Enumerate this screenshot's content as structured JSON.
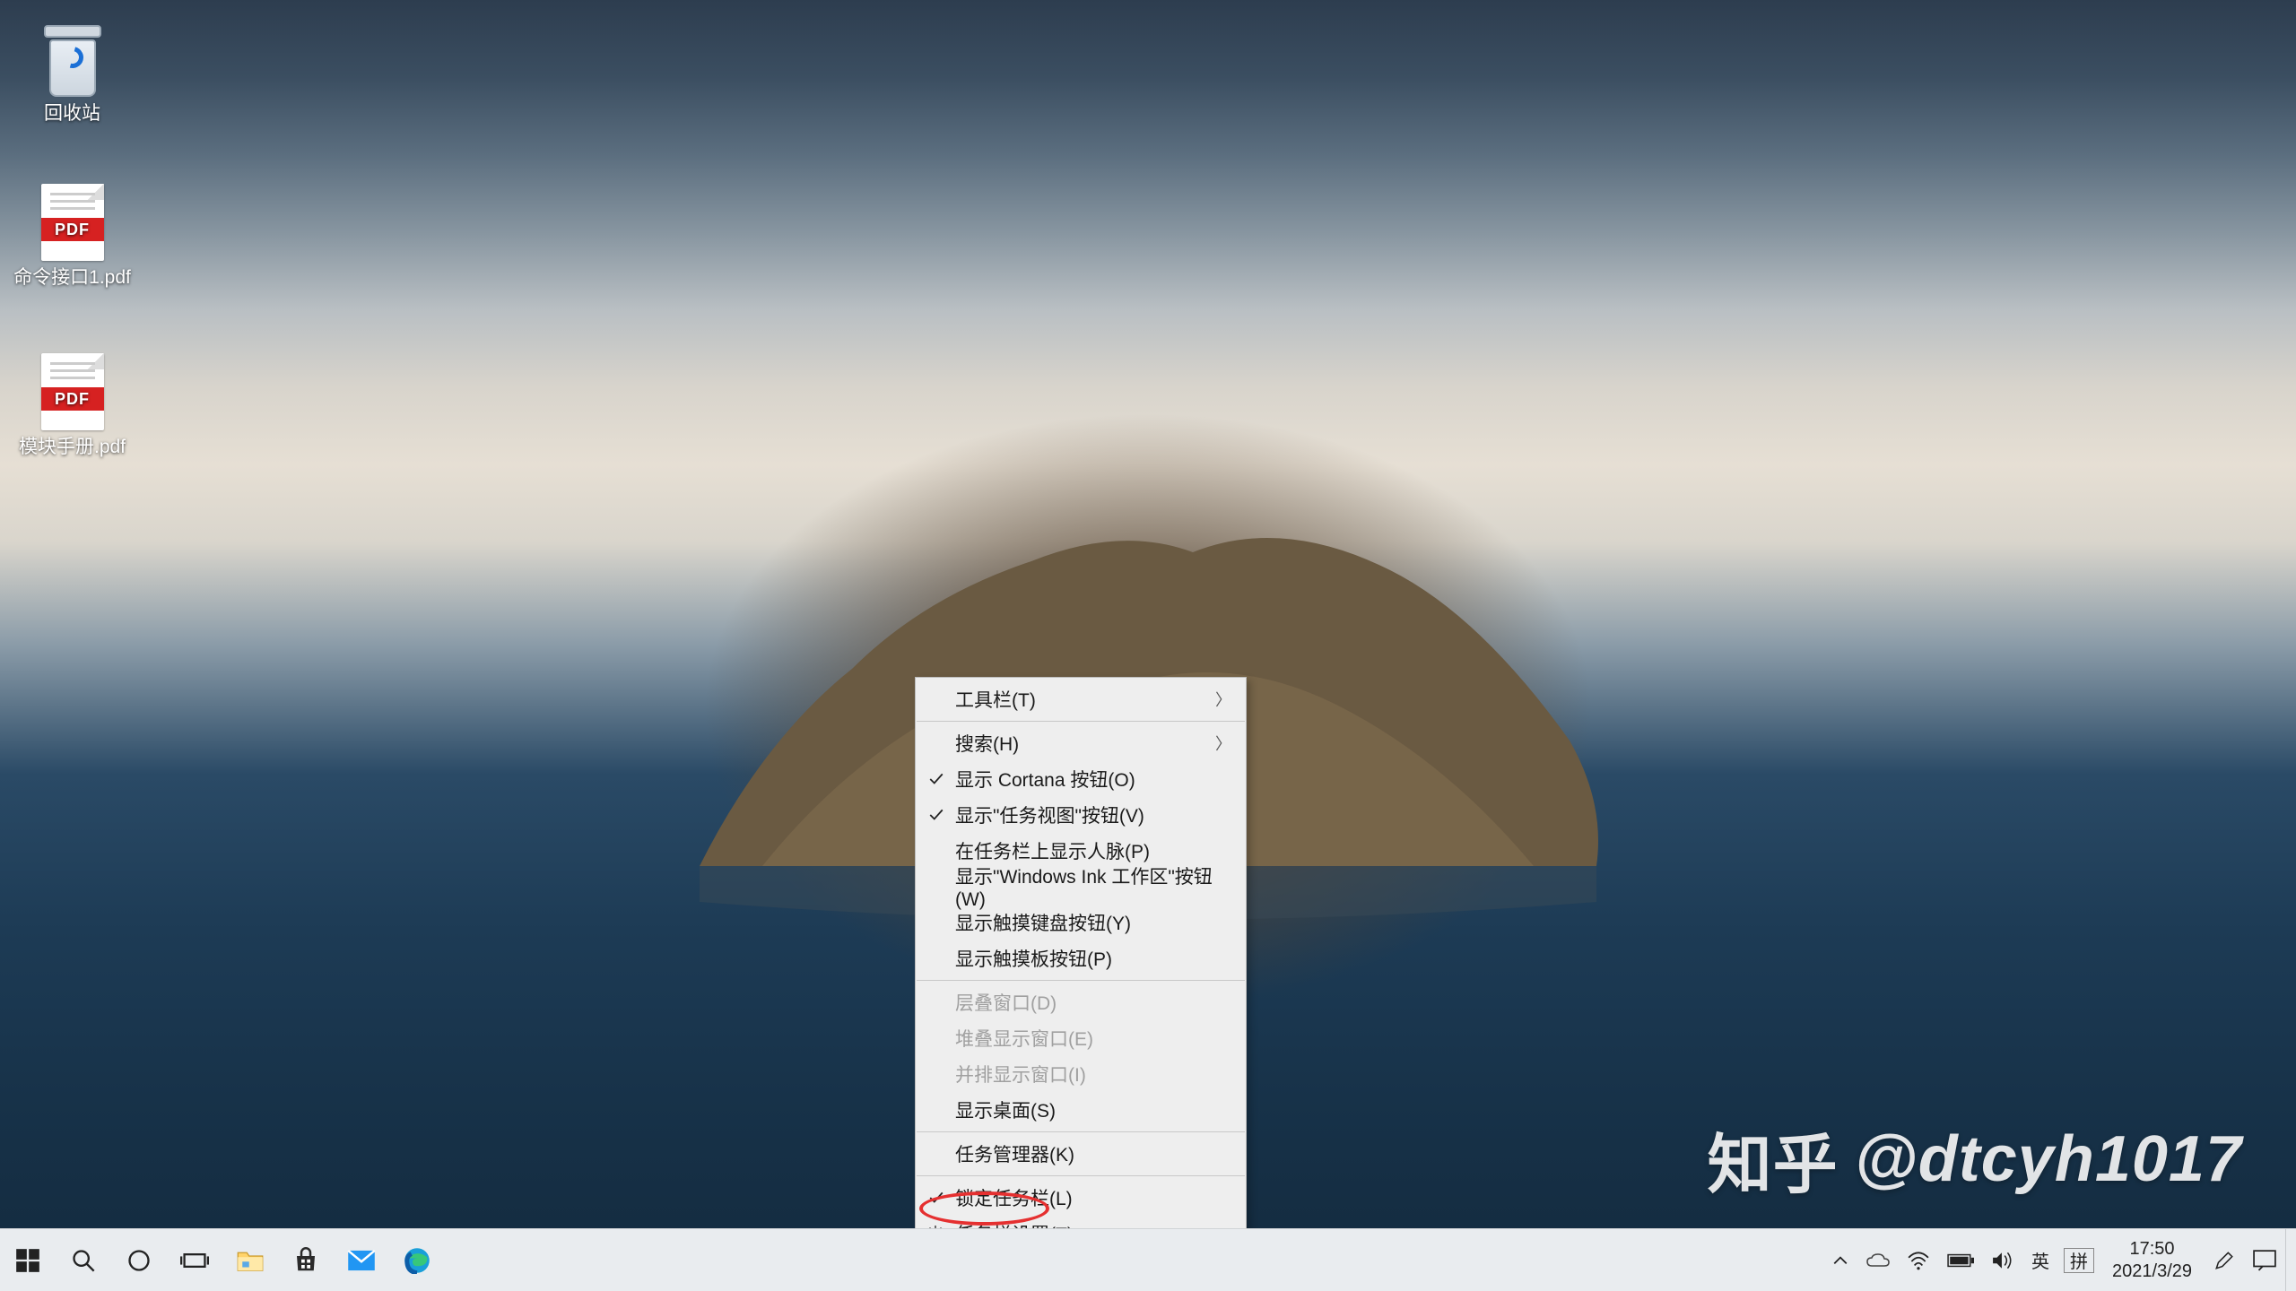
{
  "desktop_icons": {
    "recycle_bin": {
      "label": "回收站"
    },
    "pdf1": {
      "band": "PDF",
      "label": "命令接口1.pdf"
    },
    "pdf2": {
      "band": "PDF",
      "label": "模块手册.pdf"
    }
  },
  "context_menu": {
    "toolbars": "工具栏(T)",
    "search": "搜索(H)",
    "show_cortana": "显示 Cortana 按钮(O)",
    "show_taskview": "显示\"任务视图\"按钮(V)",
    "show_people": "在任务栏上显示人脉(P)",
    "show_ink": "显示\"Windows Ink 工作区\"按钮(W)",
    "show_touch_kb": "显示触摸键盘按钮(Y)",
    "show_touchpad": "显示触摸板按钮(P)",
    "cascade": "层叠窗口(D)",
    "stacked": "堆叠显示窗口(E)",
    "sidebyside": "并排显示窗口(I)",
    "show_desktop": "显示桌面(S)",
    "task_manager": "任务管理器(K)",
    "lock_taskbar": "锁定任务栏(L)",
    "taskbar_settings": "任务栏设置(T)"
  },
  "watermark": {
    "brand": "知乎",
    "handle": "@dtcyh1017"
  },
  "taskbar": {
    "ime_lang": "英",
    "ime_mode": "拼"
  },
  "clock": {
    "time": "17:50",
    "date": "2021/3/29"
  }
}
